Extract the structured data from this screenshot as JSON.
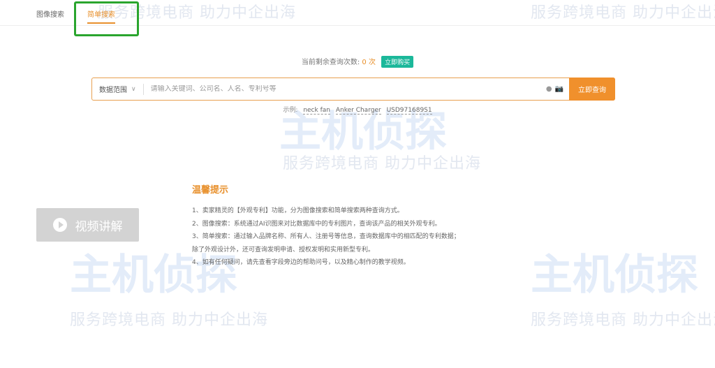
{
  "tabs": [
    {
      "label": "图像搜索"
    },
    {
      "label": "简单搜索"
    }
  ],
  "remaining": {
    "label": "当前剩余查询次数:",
    "count": "0 次",
    "buy_label": "立即购买"
  },
  "search": {
    "scope_label": "数据范围",
    "placeholder": "请输入关键词、公司名、人名、专利号等",
    "submit_label": "立即查询"
  },
  "examples": {
    "label": "示例:",
    "items": [
      "neck fan",
      "Anker Charger",
      "USD971689S1"
    ]
  },
  "video_button": {
    "label": "视频讲解"
  },
  "tips": {
    "title": "温馨提示",
    "lines": [
      "1、卖家精灵的【外观专利】功能，分为图像搜索和简单搜索两种查询方式。",
      "2、图像搜索：系统通过AI识图来对比数据库中的专利图片，查询该产品的相关外观专利。",
      "3、简单搜索：通过输入品牌名称、所有人、注册号等信息，查询数据库中的相匹配的专利数据；",
      "除了外观设计外，还可查询发明申请、授权发明和实用新型专利。",
      "4、如有任何疑问，请先查看字段旁边的帮助问号，以及精心制作的教学视频。"
    ]
  },
  "watermark": {
    "slogan": "服务跨境电商 助力中企出海",
    "logo": "主机侦探"
  }
}
